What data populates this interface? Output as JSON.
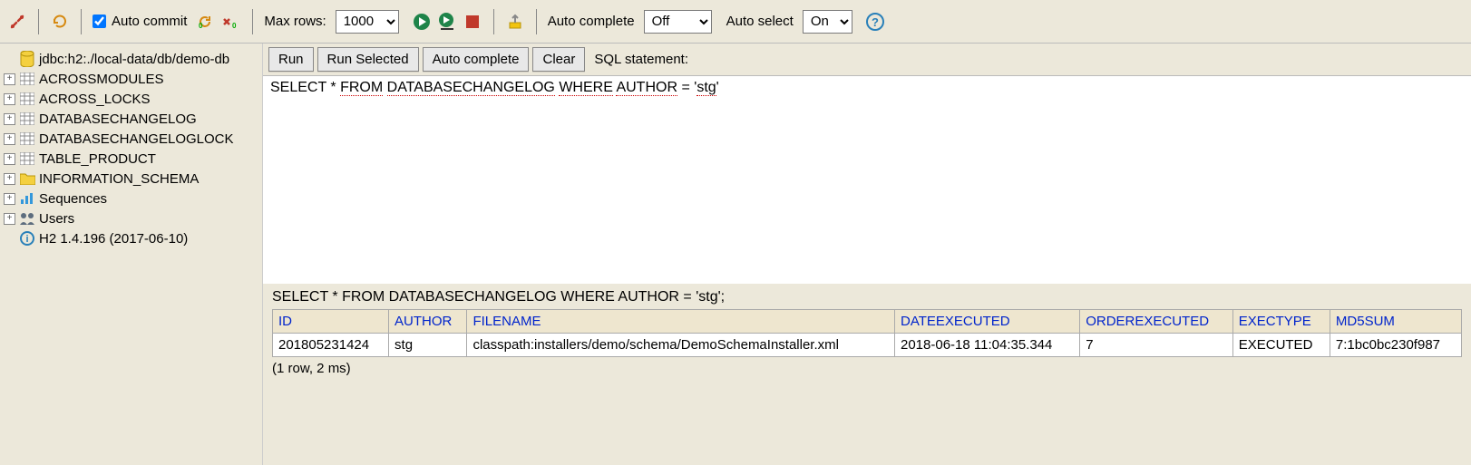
{
  "toolbar": {
    "auto_commit_label": "Auto commit",
    "auto_commit_checked": true,
    "max_rows_label": "Max rows:",
    "max_rows_value": "1000",
    "auto_complete_label": "Auto complete",
    "auto_complete_value": "Off",
    "auto_select_label": "Auto select",
    "auto_select_value": "On"
  },
  "tree": {
    "root": "jdbc:h2:./local-data/db/demo-db",
    "items": [
      {
        "label": "ACROSSMODULES",
        "icon": "table"
      },
      {
        "label": "ACROSS_LOCKS",
        "icon": "table"
      },
      {
        "label": "DATABASECHANGELOG",
        "icon": "table"
      },
      {
        "label": "DATABASECHANGELOGLOCK",
        "icon": "table"
      },
      {
        "label": "TABLE_PRODUCT",
        "icon": "table"
      },
      {
        "label": "INFORMATION_SCHEMA",
        "icon": "folder"
      },
      {
        "label": "Sequences",
        "icon": "sequences"
      },
      {
        "label": "Users",
        "icon": "users"
      }
    ],
    "version": "H2 1.4.196 (2017-06-10)"
  },
  "sql_buttons": {
    "run": "Run",
    "run_selected": "Run Selected",
    "auto_complete": "Auto complete",
    "clear": "Clear",
    "statement_label": "SQL statement:"
  },
  "sql_editor": {
    "text": "SELECT * FROM DATABASECHANGELOG WHERE AUTHOR = 'stg'"
  },
  "result": {
    "query_echo": "SELECT * FROM DATABASECHANGELOG WHERE AUTHOR = 'stg';",
    "columns": [
      "ID",
      "AUTHOR",
      "FILENAME",
      "DATEEXECUTED",
      "ORDEREXECUTED",
      "EXECTYPE",
      "MD5SUM"
    ],
    "rows": [
      [
        "201805231424",
        "stg",
        "classpath:installers/demo/schema/DemoSchemaInstaller.xml",
        "2018-06-18 11:04:35.344",
        "7",
        "EXECUTED",
        "7:1bc0bc230f987"
      ]
    ],
    "meta": "(1 row, 2 ms)"
  }
}
